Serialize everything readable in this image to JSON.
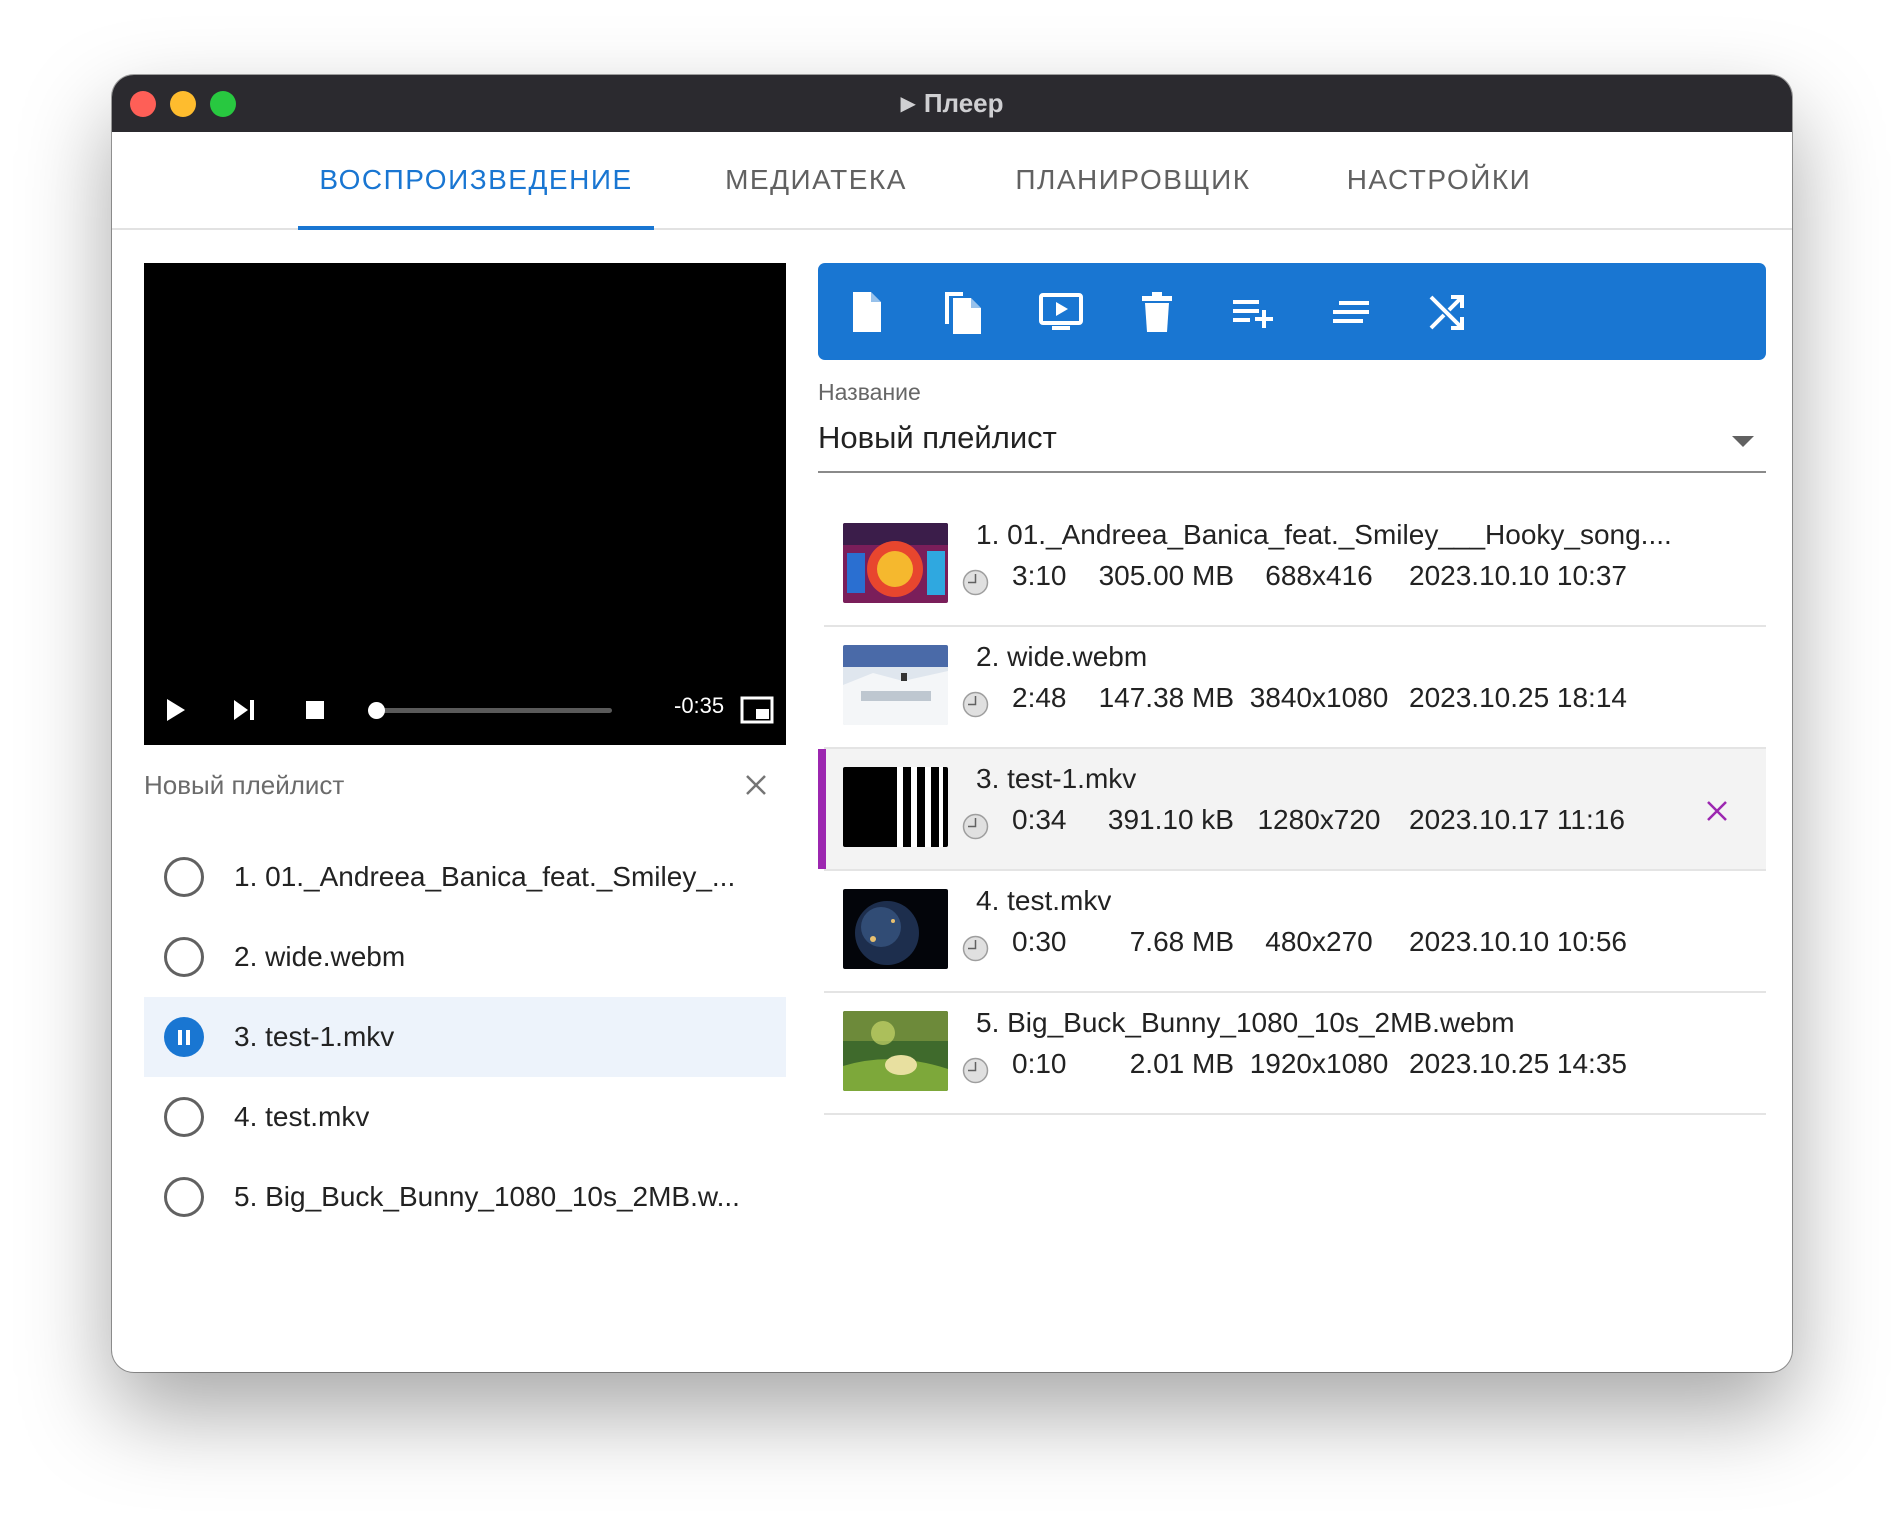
{
  "window": {
    "title": "Плеер"
  },
  "tabs": [
    {
      "label": "ВОСПРОИЗВЕДЕНИЕ",
      "active": true
    },
    {
      "label": "МЕДИАТЕКА",
      "active": false
    },
    {
      "label": "ПЛАНИРОВЩИК",
      "active": false
    },
    {
      "label": "НАСТРОЙКИ",
      "active": false
    }
  ],
  "player": {
    "time_remaining": "-0:35",
    "progress": 0.0
  },
  "left_playlist": {
    "title": "Новый плейлист",
    "items": [
      {
        "label": "1. 01._Andreea_Banica_feat._Smiley_...",
        "playing": false
      },
      {
        "label": "2. wide.webm",
        "playing": false
      },
      {
        "label": "3. test-1.mkv",
        "playing": true
      },
      {
        "label": "4. test.mkv",
        "playing": false
      },
      {
        "label": "5. Big_Buck_Bunny_1080_10s_2MB.w...",
        "playing": false
      }
    ]
  },
  "toolbar": {
    "icons": [
      "file-icon",
      "copy-icon",
      "screen-play-icon",
      "trash-icon",
      "playlist-add-icon",
      "sort-icon",
      "shuffle-icon"
    ]
  },
  "playlist_select": {
    "label": "Название",
    "value": "Новый плейлист"
  },
  "media": [
    {
      "title": "1. 01._Andreea_Banica_feat._Smiley___Hooky_song....",
      "duration": "3:10",
      "size": "305.00 MB",
      "resolution": "688x416",
      "date": "2023.10.10 10:37",
      "active": false
    },
    {
      "title": "2. wide.webm",
      "duration": "2:48",
      "size": "147.38 MB",
      "resolution": "3840x1080",
      "date": "2023.10.25 18:14",
      "active": false
    },
    {
      "title": "3. test-1.mkv",
      "duration": "0:34",
      "size": "391.10 kB",
      "resolution": "1280x720",
      "date": "2023.10.17 11:16",
      "active": true
    },
    {
      "title": "4. test.mkv",
      "duration": "0:30",
      "size": "7.68 MB",
      "resolution": "480x270",
      "date": "2023.10.10 10:56",
      "active": false
    },
    {
      "title": "5. Big_Buck_Bunny_1080_10s_2MB.webm",
      "duration": "0:10",
      "size": "2.01 MB",
      "resolution": "1920x1080",
      "date": "2023.10.25 14:35",
      "active": false
    }
  ],
  "colors": {
    "accent": "#1976d2",
    "selected_marker": "#9c27b0",
    "titlebar": "#2b2a2f"
  }
}
